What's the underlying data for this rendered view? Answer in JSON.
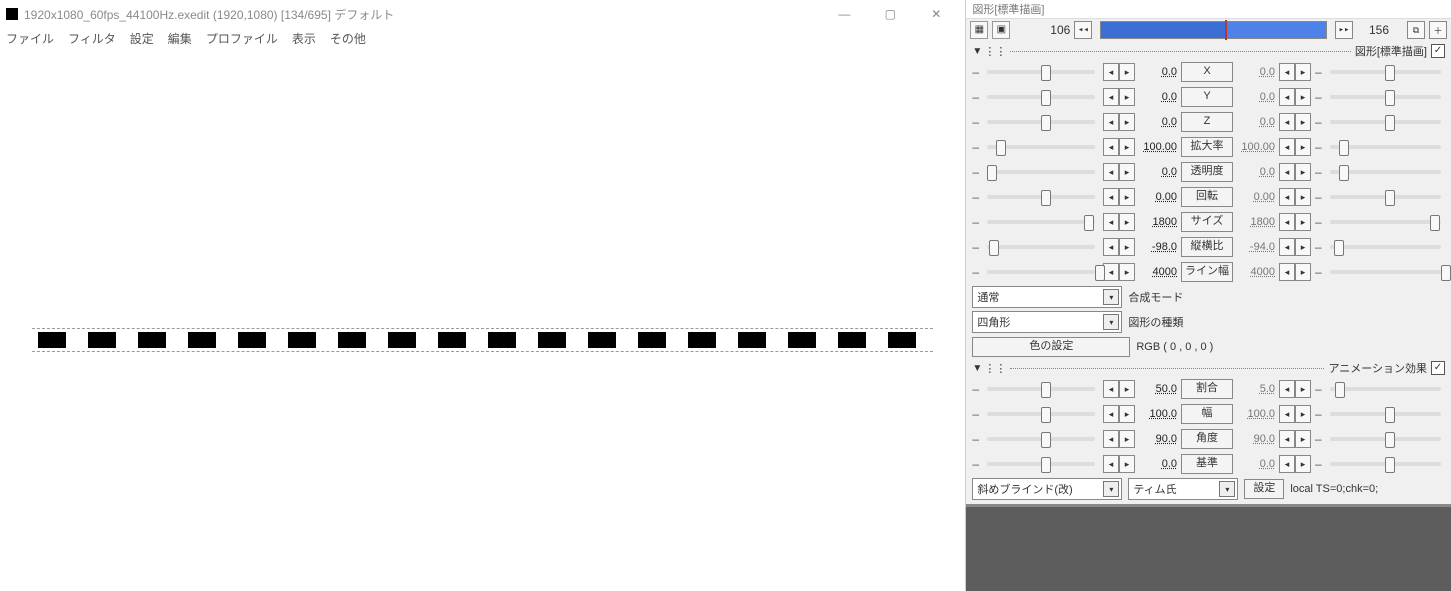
{
  "main": {
    "title": "1920x1080_60fps_44100Hz.exedit (1920,1080)  [134/695]  デフォルト",
    "menu": [
      "ファイル",
      "フィルタ",
      "設定",
      "編集",
      "プロファイル",
      "表示",
      "その他"
    ]
  },
  "panel": {
    "title": "図形[標準描画]",
    "frame_l": "106",
    "frame_r": "156",
    "sec1": {
      "label": "図形[標準描画]",
      "checked": "✓"
    },
    "sec2": {
      "label": "アニメーション効果",
      "checked": "✓"
    },
    "rows1": [
      {
        "v1": "0.0",
        "name": "X",
        "v2": "0.0",
        "k1": 50,
        "k2": 50
      },
      {
        "v1": "0.0",
        "name": "Y",
        "v2": "0.0",
        "k1": 50,
        "k2": 50
      },
      {
        "v1": "0.0",
        "name": "Z",
        "v2": "0.0",
        "k1": 50,
        "k2": 50
      },
      {
        "v1": "100.00",
        "name": "拡大率",
        "v2": "100.00",
        "k1": 8,
        "k2": 8
      },
      {
        "v1": "0.0",
        "name": "透明度",
        "v2": "0.0",
        "k1": 0,
        "k2": 8
      },
      {
        "v1": "0.00",
        "name": "回転",
        "v2": "0.00",
        "k1": 50,
        "k2": 50
      },
      {
        "v1": "1800",
        "name": "サイズ",
        "v2": "1800",
        "k1": 90,
        "k2": 90
      },
      {
        "v1": "-98.0",
        "name": "縦横比",
        "v2": "-94.0",
        "k1": 2,
        "k2": 4
      },
      {
        "v1": "4000",
        "name": "ライン幅",
        "v2": "4000",
        "k1": 100,
        "k2": 100
      }
    ],
    "blend": {
      "label": "合成モード",
      "value": "通常"
    },
    "shape": {
      "label": "図形の種類",
      "value": "四角形"
    },
    "color": {
      "btn": "色の設定",
      "val": "RGB ( 0 , 0 , 0 )"
    },
    "rows2": [
      {
        "v1": "50.0",
        "name": "割合",
        "v2": "5.0",
        "k1": 50,
        "k2": 5
      },
      {
        "v1": "100.0",
        "name": "幅",
        "v2": "100.0",
        "k1": 50,
        "k2": 50
      },
      {
        "v1": "90.0",
        "name": "角度",
        "v2": "90.0",
        "k1": 50,
        "k2": 50
      },
      {
        "v1": "0.0",
        "name": "基準",
        "v2": "0.0",
        "k1": 50,
        "k2": 50
      }
    ],
    "anim": {
      "c1": "斜めブラインド(改)",
      "c2": "ティム氏",
      "btn": "設定",
      "note": "local TS=0;chk=0;"
    }
  }
}
